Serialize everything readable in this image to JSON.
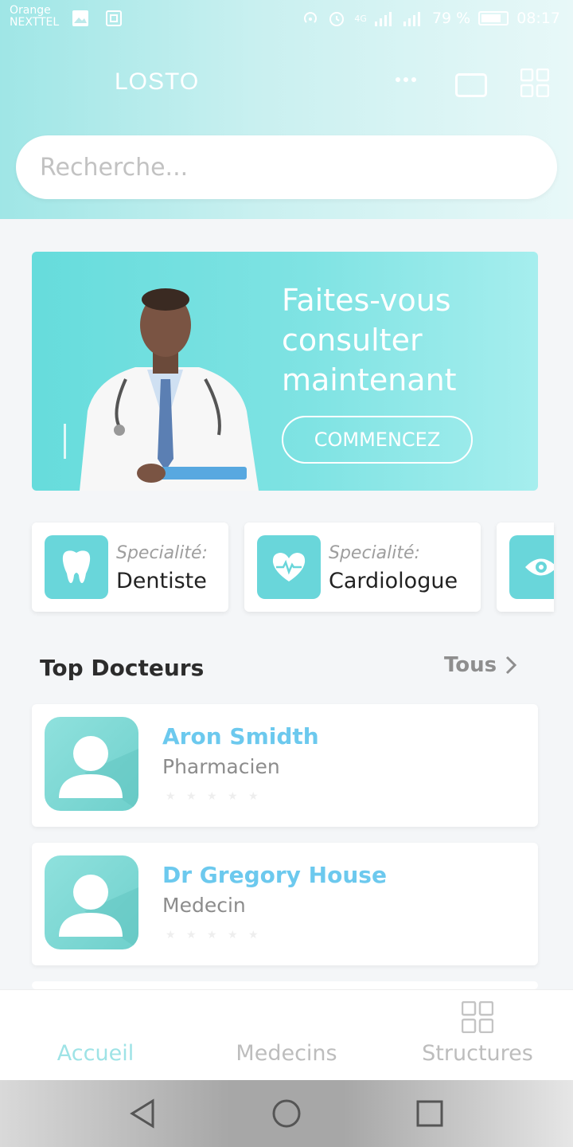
{
  "status_bar": {
    "carrier_line1": "Orange",
    "carrier_line2": "NEXTTEL",
    "network": "4G",
    "battery_percent": "79 %",
    "time": "08:17"
  },
  "app": {
    "title": "LOSTO"
  },
  "search": {
    "placeholder": "Recherche..."
  },
  "banner": {
    "line1": "Faites-vous",
    "line2": "consulter",
    "line3": "maintenant",
    "button_label": "COMMENCEZ"
  },
  "specialities": [
    {
      "label": "Specialité:",
      "value": "Dentiste",
      "icon": "tooth-icon"
    },
    {
      "label": "Specialité:",
      "value": "Cardiologue",
      "icon": "heart-pulse-icon"
    },
    {
      "label": "",
      "value": "",
      "icon": "eye-icon"
    }
  ],
  "top_doctors": {
    "title": "Top Docteurs",
    "see_all": "Tous",
    "items": [
      {
        "name": "Aron Smidth",
        "role": "Pharmacien",
        "rating": 0
      },
      {
        "name": "Dr Gregory House",
        "role": "Medecin",
        "rating": 0
      }
    ]
  },
  "bottom_nav": {
    "items": [
      {
        "label": "Accueil",
        "active": true
      },
      {
        "label": "Medecins",
        "active": false
      },
      {
        "label": "Structures",
        "active": false
      }
    ]
  },
  "colors": {
    "accent": "#69d6da",
    "doctor_name": "#6cc9ee",
    "active_nav": "#9ee3e6"
  }
}
